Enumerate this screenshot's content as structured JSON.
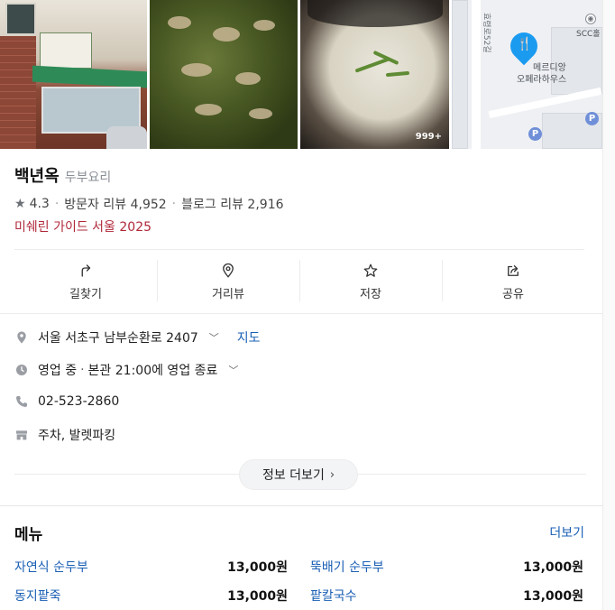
{
  "photos": {
    "count_badge": "999+",
    "map": {
      "road_label": "효령로52길",
      "pin_glyph": "🍴",
      "place_label_line1": "메르디앙",
      "place_label_line2": "오페라하우스",
      "corner_label": "SCC홀",
      "parking_symbol": "P"
    }
  },
  "place": {
    "name": "백년옥",
    "category": "두부요리",
    "rating": "4.3",
    "visitor_reviews": "방문자 리뷰 4,952",
    "blog_reviews": "블로그 리뷰 2,916",
    "badge": "미쉐린 가이드 서울 2025"
  },
  "actions": [
    {
      "label": "길찾기",
      "icon": "directions-icon"
    },
    {
      "label": "거리뷰",
      "icon": "street-view-pin-icon"
    },
    {
      "label": "저장",
      "icon": "star-outline-icon"
    },
    {
      "label": "공유",
      "icon": "share-icon"
    }
  ],
  "info": {
    "address": "서울 서초구 남부순환로 2407",
    "map_link": "지도",
    "hours_status": "영업 중",
    "hours_detail": "본관 21:00에 영업 종료",
    "phone": "02-523-2860",
    "parking": "주차, 발렛파킹",
    "more_button": "정보 더보기"
  },
  "menu": {
    "title": "메뉴",
    "more": "더보기",
    "items": [
      {
        "name": "자연식 순두부",
        "price": "13,000원"
      },
      {
        "name": "뚝배기 순두부",
        "price": "13,000원"
      },
      {
        "name": "동지팥죽",
        "price": "13,000원"
      },
      {
        "name": "팥칼국수",
        "price": "13,000원"
      }
    ]
  },
  "colors": {
    "link": "#1a5fb4",
    "michelin": "#b0283a",
    "pin": "#1b9bf0"
  }
}
